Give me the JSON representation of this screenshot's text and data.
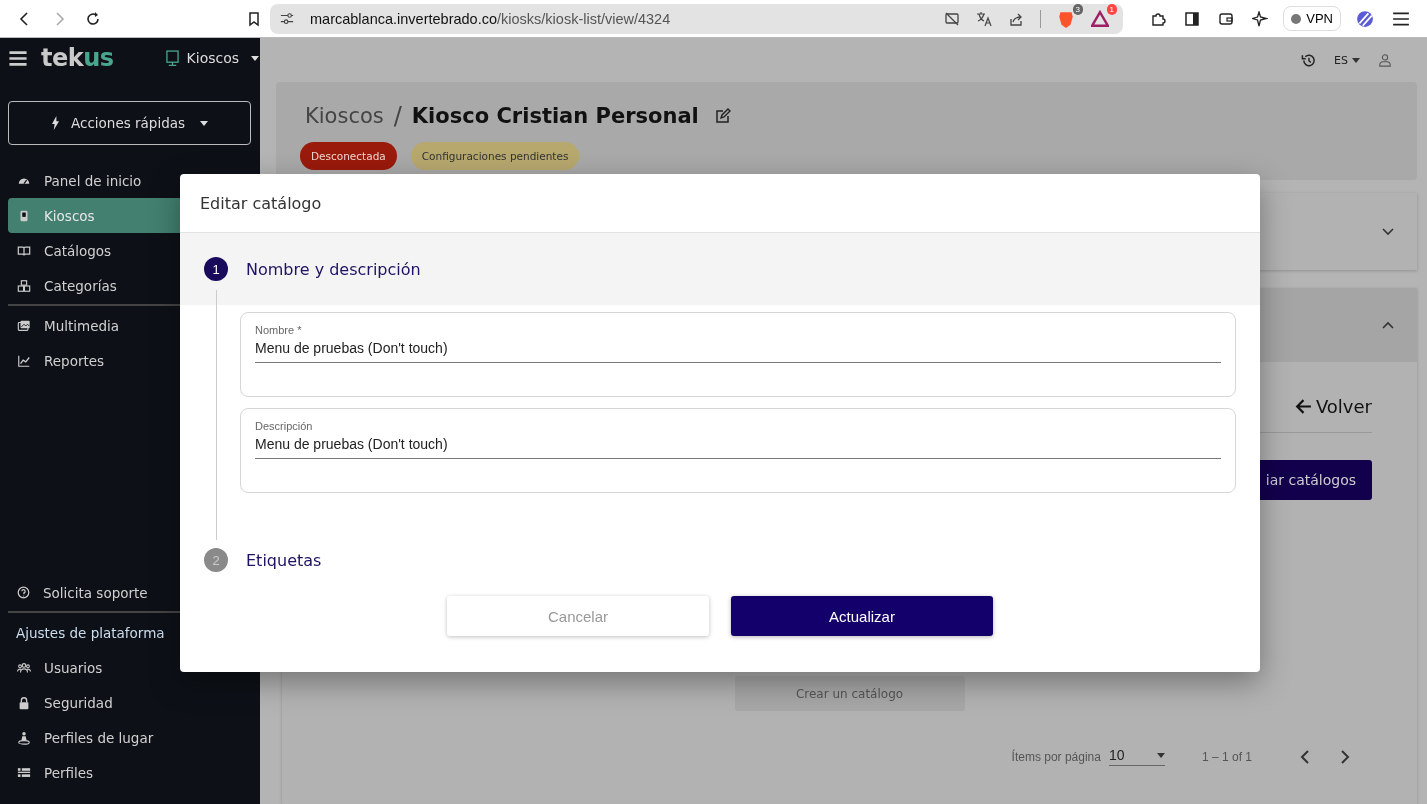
{
  "browser": {
    "url_host": "marcablanca.invertebrado.co",
    "url_path": "/kiosks/kiosk-list/view/4324",
    "shields_count": "3",
    "rewards_count": "1",
    "vpn_label": "VPN"
  },
  "sidebar": {
    "logo_prefix": "tek",
    "logo_suffix": "us",
    "module": "Kioscos",
    "quick_actions": "Acciones rápidas",
    "items": [
      {
        "label": "Panel de inicio",
        "selected": false
      },
      {
        "label": "Kioscos",
        "selected": true
      },
      {
        "label": "Catálogos",
        "selected": false
      },
      {
        "label": "Categorías",
        "selected": false
      },
      {
        "label": "Multimedia",
        "selected": false
      },
      {
        "label": "Reportes",
        "selected": false
      }
    ],
    "support": "Solicita soporte",
    "settings_title": "Ajustes de plataforma",
    "settings_items": [
      {
        "label": "Usuarios",
        "selected": false
      },
      {
        "label": "Seguridad",
        "selected": false
      },
      {
        "label": "Perfiles de lugar",
        "selected": false
      },
      {
        "label": "Perfiles",
        "selected": false
      }
    ]
  },
  "topbar": {
    "language": "ES"
  },
  "page": {
    "breadcrumb": "Kioscos",
    "separator": "/",
    "title": "Kiosco Cristian Personal",
    "badges": [
      {
        "label": "Desconectada",
        "color": "#9a1a0c"
      },
      {
        "label": "Configuraciones pendientes",
        "color": "#b7a86e"
      }
    ]
  },
  "panels": [
    {
      "expanded": false
    },
    {
      "expanded": true
    }
  ],
  "catalogs": {
    "back": "Volver",
    "manage_button": "iar catálogos",
    "create_button": "Crear un catálogo",
    "paginator": {
      "label": "Ítems por página",
      "page_size": "10",
      "range": "1 – 1 of 1"
    }
  },
  "dialog": {
    "title": "Editar catálogo",
    "steps": [
      {
        "number": "1",
        "title": "Nombre y descripción",
        "selected": true,
        "fields": [
          {
            "label": "Nombre *",
            "value": "Menu de pruebas (Don't touch)"
          },
          {
            "label": "Descripción",
            "value": "Menu de pruebas (Don't touch)"
          }
        ]
      },
      {
        "number": "2",
        "title": "Etiquetas",
        "selected": false
      }
    ],
    "buttons": [
      {
        "label": "Cancelar",
        "kind": "secondary"
      },
      {
        "label": "Actualizar",
        "kind": "primary"
      }
    ]
  }
}
